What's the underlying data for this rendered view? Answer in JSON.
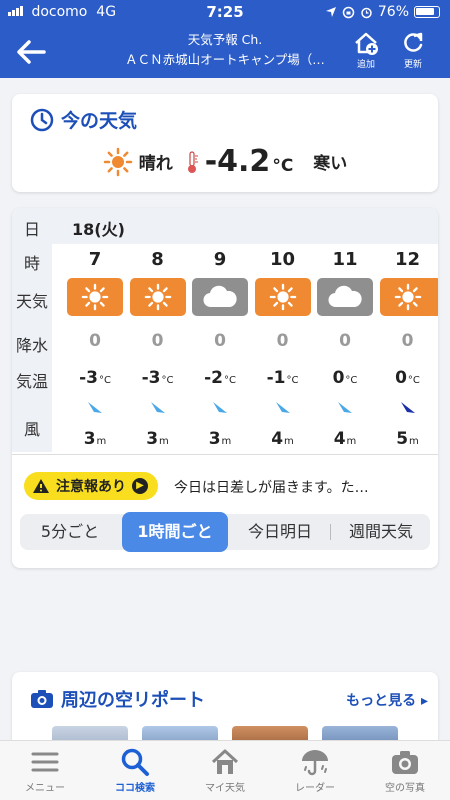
{
  "status": {
    "carrier": "docomo",
    "network": "4G",
    "time": "7:25",
    "battery": "76%"
  },
  "header": {
    "line1": "天気予報 Ch.",
    "line2": "ＡＣＮ赤城山オートキャンプ場（…",
    "add_label": "追加",
    "refresh_label": "更新"
  },
  "now": {
    "title": "今の天気",
    "condition": "晴れ",
    "temp": "-4.2",
    "unit": "°C",
    "feel": "寒い"
  },
  "forecast": {
    "labels": {
      "day": "日",
      "hour": "時",
      "weather": "天気",
      "precip": "降水",
      "temp": "気温",
      "wind": "風"
    },
    "day": "18(火)",
    "hours": [
      {
        "hour": "7",
        "weather": "sun",
        "precip": "0",
        "temp": "-3",
        "wind_speed": "3",
        "wind_strong": false
      },
      {
        "hour": "8",
        "weather": "sun",
        "precip": "0",
        "temp": "-3",
        "wind_speed": "3",
        "wind_strong": false
      },
      {
        "hour": "9",
        "weather": "cloud",
        "precip": "0",
        "temp": "-2",
        "wind_speed": "3",
        "wind_strong": false
      },
      {
        "hour": "10",
        "weather": "sun",
        "precip": "0",
        "temp": "-1",
        "wind_speed": "4",
        "wind_strong": false
      },
      {
        "hour": "11",
        "weather": "cloud",
        "precip": "0",
        "temp": "0",
        "wind_speed": "4",
        "wind_strong": false
      },
      {
        "hour": "12",
        "weather": "sun",
        "precip": "0",
        "temp": "0",
        "wind_speed": "5",
        "wind_strong": true
      }
    ],
    "temp_unit": "°C",
    "wind_unit": "m"
  },
  "warning": {
    "badge": "注意報あり",
    "text": "今日は日差しが届きます。た…"
  },
  "tabs_seg": [
    "5分ごと",
    "1時間ごと",
    "今日明日",
    "週間天気"
  ],
  "report": {
    "title": "周辺の空リポート",
    "more": "もっと見る"
  },
  "tabbar": [
    "メニュー",
    "ココ検索",
    "マイ天気",
    "レーダー",
    "空の写真"
  ],
  "colors": {
    "brand": "#2b5cc8",
    "sun": "#f08a32",
    "cloud": "#8f8f8f",
    "warning": "#f8de1e",
    "active": "#4a8ae6"
  }
}
